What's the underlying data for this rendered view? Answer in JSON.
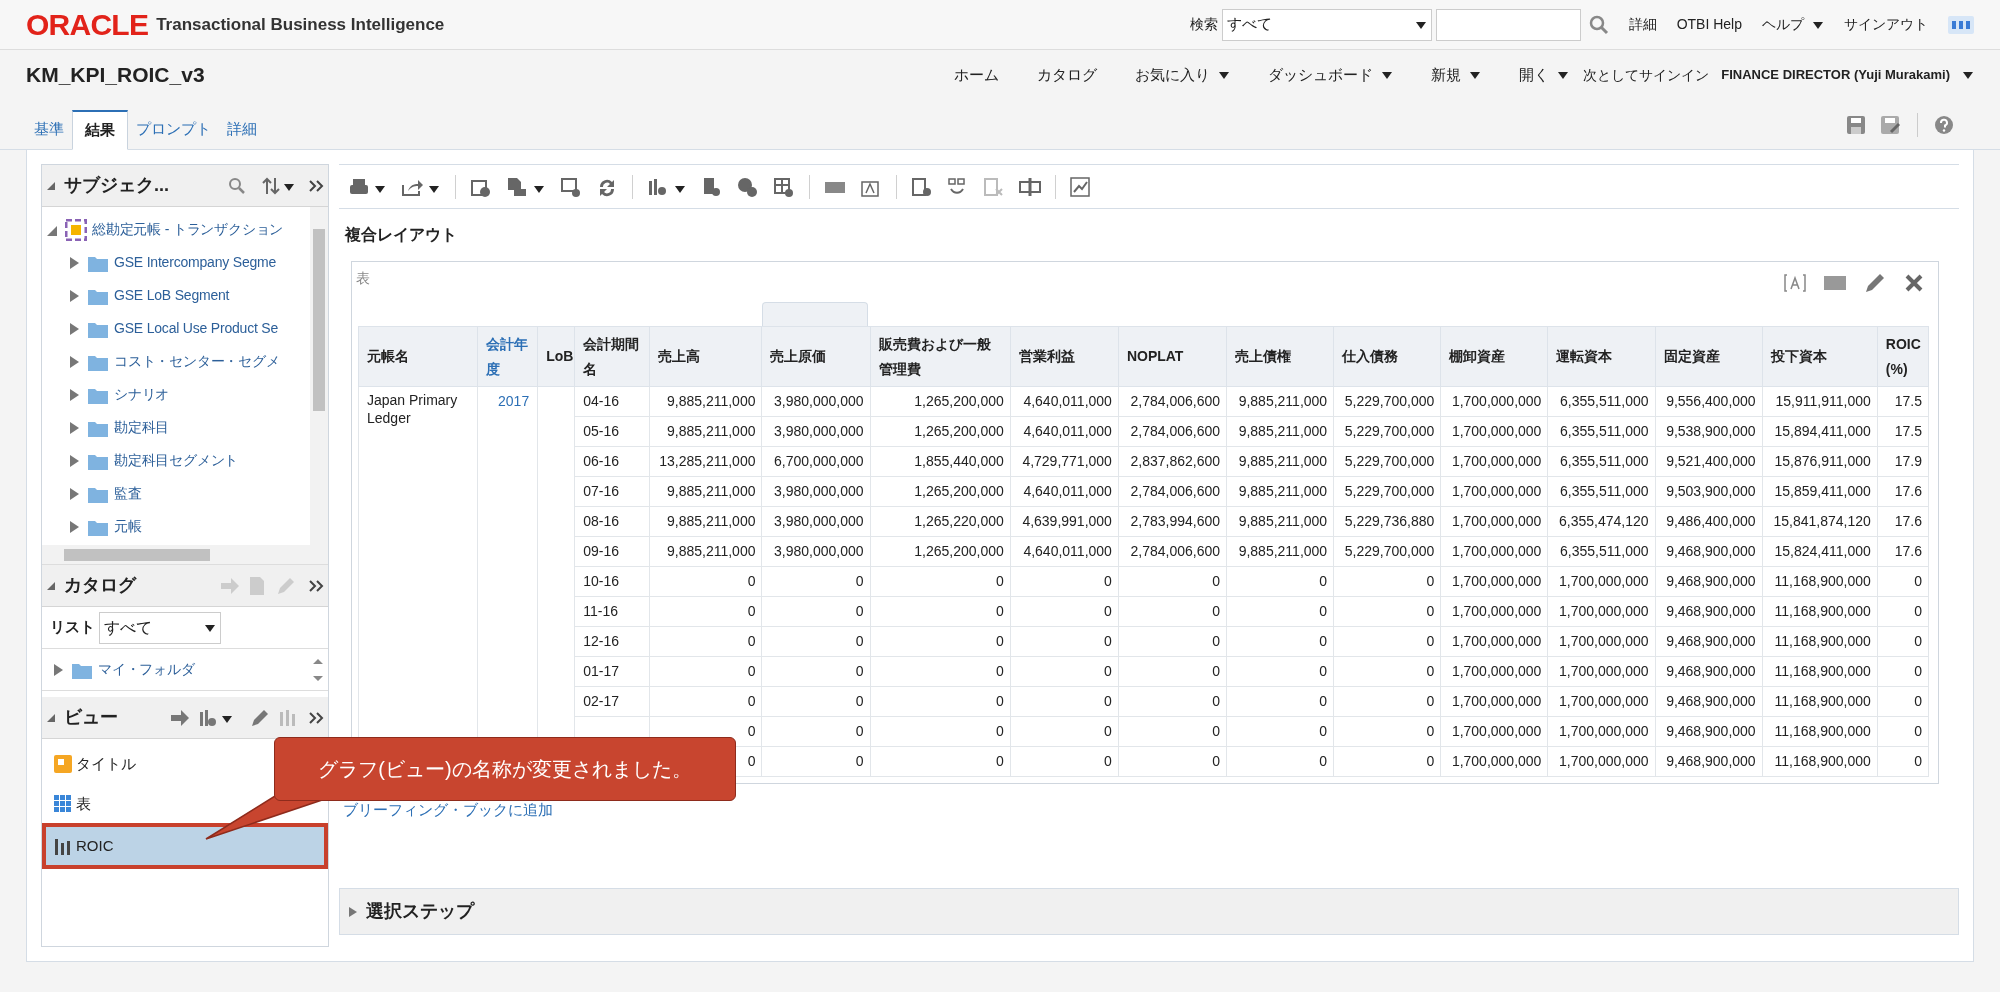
{
  "header": {
    "logo": "ORACLE",
    "product": "Transactional Business Intelligence",
    "search_label": "検索",
    "search_scope": "すべて",
    "links": [
      {
        "label": "詳細",
        "menu": false
      },
      {
        "label": "OTBI Help",
        "menu": false
      },
      {
        "label": "ヘルプ",
        "menu": true
      },
      {
        "label": "サインアウト",
        "menu": false
      }
    ]
  },
  "page_title": "KM_KPI_ROIC_v3",
  "nav": [
    {
      "label": "ホーム",
      "menu": false
    },
    {
      "label": "カタログ",
      "menu": false
    },
    {
      "label": "お気に入り",
      "menu": true
    },
    {
      "label": "ダッシュボード",
      "menu": true
    },
    {
      "label": "新規",
      "menu": true
    },
    {
      "label": "開く",
      "menu": true
    }
  ],
  "sign_in_as": {
    "label": "次としてサインイン",
    "user": "FINANCE DIRECTOR (Yuji Murakami)"
  },
  "tabs": [
    {
      "label": "基準",
      "selected": false
    },
    {
      "label": "結果",
      "selected": true
    },
    {
      "label": "プロンプト",
      "selected": false
    },
    {
      "label": "詳細",
      "selected": false
    }
  ],
  "subject_areas": {
    "title": "サブジェク...",
    "tree": [
      {
        "label": "総勘定元帳 - トランザクション",
        "expanded": true,
        "children": [
          {
            "label": "GSE Intercompany Segme",
            "expanded": false
          },
          {
            "label": "GSE LoB Segment",
            "expanded": false
          },
          {
            "label": "GSE Local Use Product Se",
            "expanded": false
          },
          {
            "label": "コスト・センター・セグメ",
            "expanded": false
          },
          {
            "label": "シナリオ",
            "expanded": false
          },
          {
            "label": "勘定科目",
            "expanded": false
          },
          {
            "label": "勘定科目セグメント",
            "expanded": false
          },
          {
            "label": "監査",
            "expanded": false
          },
          {
            "label": "元帳",
            "expanded": false
          }
        ]
      }
    ]
  },
  "catalog": {
    "title": "カタログ",
    "list_label": "リスト",
    "list_value": "すべて",
    "tree": [
      {
        "label": "マイ・フォルダ",
        "expanded": false
      }
    ]
  },
  "views": {
    "title": "ビュー",
    "items": [
      {
        "kind": "title",
        "label": "タイトル",
        "selected": false
      },
      {
        "kind": "table",
        "label": "表",
        "selected": false
      },
      {
        "kind": "chart",
        "label": "ROIC",
        "selected": true
      }
    ]
  },
  "layout_title": "複合レイアウト",
  "table_view": {
    "title": "表",
    "columns": [
      {
        "label": "元帳名",
        "link": false
      },
      {
        "label": "会計年度",
        "link": true
      },
      {
        "label": "LoB",
        "link": false
      },
      {
        "label": "会計期間名",
        "link": false
      },
      {
        "label": "売上高",
        "link": false
      },
      {
        "label": "売上原価",
        "link": false
      },
      {
        "label": "販売費および一般管理費",
        "link": false
      },
      {
        "label": "営業利益",
        "link": false
      },
      {
        "label": "NOPLAT",
        "link": false
      },
      {
        "label": "売上債権",
        "link": false
      },
      {
        "label": "仕入債務",
        "link": false
      },
      {
        "label": "棚卸資産",
        "link": false
      },
      {
        "label": "運転資本",
        "link": false
      },
      {
        "label": "固定資産",
        "link": false
      },
      {
        "label": "投下資本",
        "link": false
      },
      {
        "label": "ROIC (%)",
        "link": false
      }
    ],
    "ledger": "Japan Primary Ledger",
    "fiscal_year": "2017",
    "rows": [
      {
        "period": "04-16",
        "values": [
          "9,885,211,000",
          "3,980,000,000",
          "1,265,200,000",
          "4,640,011,000",
          "2,784,006,600",
          "9,885,211,000",
          "5,229,700,000",
          "1,700,000,000",
          "6,355,511,000",
          "9,556,400,000",
          "15,911,911,000",
          "17.5"
        ]
      },
      {
        "period": "05-16",
        "values": [
          "9,885,211,000",
          "3,980,000,000",
          "1,265,200,000",
          "4,640,011,000",
          "2,784,006,600",
          "9,885,211,000",
          "5,229,700,000",
          "1,700,000,000",
          "6,355,511,000",
          "9,538,900,000",
          "15,894,411,000",
          "17.5"
        ]
      },
      {
        "period": "06-16",
        "values": [
          "13,285,211,000",
          "6,700,000,000",
          "1,855,440,000",
          "4,729,771,000",
          "2,837,862,600",
          "9,885,211,000",
          "5,229,700,000",
          "1,700,000,000",
          "6,355,511,000",
          "9,521,400,000",
          "15,876,911,000",
          "17.9"
        ]
      },
      {
        "period": "07-16",
        "values": [
          "9,885,211,000",
          "3,980,000,000",
          "1,265,200,000",
          "4,640,011,000",
          "2,784,006,600",
          "9,885,211,000",
          "5,229,700,000",
          "1,700,000,000",
          "6,355,511,000",
          "9,503,900,000",
          "15,859,411,000",
          "17.6"
        ]
      },
      {
        "period": "08-16",
        "values": [
          "9,885,211,000",
          "3,980,000,000",
          "1,265,220,000",
          "4,639,991,000",
          "2,783,994,600",
          "9,885,211,000",
          "5,229,736,880",
          "1,700,000,000",
          "6,355,474,120",
          "9,486,400,000",
          "15,841,874,120",
          "17.6"
        ]
      },
      {
        "period": "09-16",
        "values": [
          "9,885,211,000",
          "3,980,000,000",
          "1,265,200,000",
          "4,640,011,000",
          "2,784,006,600",
          "9,885,211,000",
          "5,229,700,000",
          "1,700,000,000",
          "6,355,511,000",
          "9,468,900,000",
          "15,824,411,000",
          "17.6"
        ]
      },
      {
        "period": "10-16",
        "values": [
          "0",
          "0",
          "0",
          "0",
          "0",
          "0",
          "0",
          "1,700,000,000",
          "1,700,000,000",
          "9,468,900,000",
          "11,168,900,000",
          "0"
        ]
      },
      {
        "period": "11-16",
        "values": [
          "0",
          "0",
          "0",
          "0",
          "0",
          "0",
          "0",
          "1,700,000,000",
          "1,700,000,000",
          "9,468,900,000",
          "11,168,900,000",
          "0"
        ]
      },
      {
        "period": "12-16",
        "values": [
          "0",
          "0",
          "0",
          "0",
          "0",
          "0",
          "0",
          "1,700,000,000",
          "1,700,000,000",
          "9,468,900,000",
          "11,168,900,000",
          "0"
        ]
      },
      {
        "period": "01-17",
        "values": [
          "0",
          "0",
          "0",
          "0",
          "0",
          "0",
          "0",
          "1,700,000,000",
          "1,700,000,000",
          "9,468,900,000",
          "11,168,900,000",
          "0"
        ]
      },
      {
        "period": "02-17",
        "values": [
          "0",
          "0",
          "0",
          "0",
          "0",
          "0",
          "0",
          "1,700,000,000",
          "1,700,000,000",
          "9,468,900,000",
          "11,168,900,000",
          "0"
        ]
      },
      {
        "values": [
          "0",
          "0",
          "0",
          "0",
          "0",
          "0",
          "0",
          "1,700,000,000",
          "1,700,000,000",
          "9,468,900,000",
          "11,168,900,000",
          "0"
        ]
      },
      {
        "values": [
          "0",
          "0",
          "0",
          "0",
          "0",
          "0",
          "0",
          "1,700,000,000",
          "1,700,000,000",
          "9,468,900,000",
          "11,168,900,000",
          "0"
        ]
      }
    ]
  },
  "briefing_link": "ブリーフィング・ブックに追加",
  "selection_steps": {
    "label": "選択ステップ",
    "expanded": false
  },
  "callout": {
    "text": "グラフ(ビュー)の名称が変更されました。"
  }
}
